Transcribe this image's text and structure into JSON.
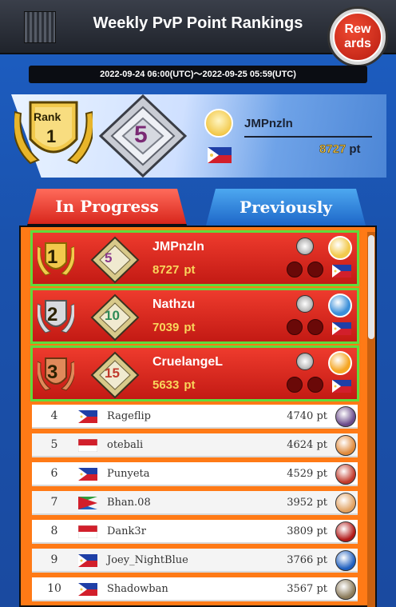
{
  "header": {
    "title": "Weekly PvP Point Rankings",
    "rewards_label": "Rew\nards"
  },
  "period": "2022-09-24 06:00(UTC)〜2022-09-25 05:59(UTC)",
  "self": {
    "rank_word": "Rank",
    "rank_number": "1",
    "level": "5",
    "name": "JMPnzln",
    "points": "8727",
    "pt_unit": "pt",
    "flag": "philippines-flag",
    "avatar": "yellow-bird-avatar"
  },
  "tabs": [
    {
      "label": "In Progress",
      "active": true
    },
    {
      "label": "Previously",
      "active": false
    }
  ],
  "top_entries": [
    {
      "rank": "1",
      "level": "5",
      "name": "JMPnzln",
      "points": "8727",
      "pt_unit": "pt",
      "flag": "philippines-flag",
      "medal": "gold",
      "avatar_color": "#f2c94c",
      "level_color": "#8b3a8a"
    },
    {
      "rank": "2",
      "level": "10",
      "name": "Nathzu",
      "points": "7039",
      "pt_unit": "pt",
      "flag": "philippines-flag",
      "medal": "silver",
      "avatar_color": "#3b8fd9",
      "level_color": "#2e8b57"
    },
    {
      "rank": "3",
      "level": "15",
      "name": "CruelangeL",
      "points": "5633",
      "pt_unit": "pt",
      "flag": "philippines-flag",
      "medal": "bronze",
      "avatar_color": "#f5a623",
      "level_color": "#c0392b"
    }
  ],
  "entries": [
    {
      "rank": "4",
      "name": "Rageflip",
      "points": "4740 pt",
      "flag": "philippines-flag",
      "avatar_color": "#6a4a8a"
    },
    {
      "rank": "5",
      "name": "otebali",
      "points": "4624 pt",
      "flag": "indonesia-flag",
      "avatar_color": "#e08a3c"
    },
    {
      "rank": "6",
      "name": "Punyeta",
      "points": "4529 pt",
      "flag": "philippines-flag",
      "avatar_color": "#c0392b"
    },
    {
      "rank": "7",
      "name": "Bhan.08",
      "points": "3952 pt",
      "flag": "eritrea-flag",
      "avatar_color": "#e0a060"
    },
    {
      "rank": "8",
      "name": "Dank3r",
      "points": "3809 pt",
      "flag": "indonesia-flag",
      "avatar_color": "#b01818"
    },
    {
      "rank": "9",
      "name": "Joey_NightBlue",
      "points": "3766 pt",
      "flag": "philippines-flag",
      "avatar_color": "#1f5fbf"
    },
    {
      "rank": "10",
      "name": "Shadowban",
      "points": "3567 pt",
      "flag": "philippines-flag",
      "avatar_color": "#8a7a5a"
    }
  ]
}
